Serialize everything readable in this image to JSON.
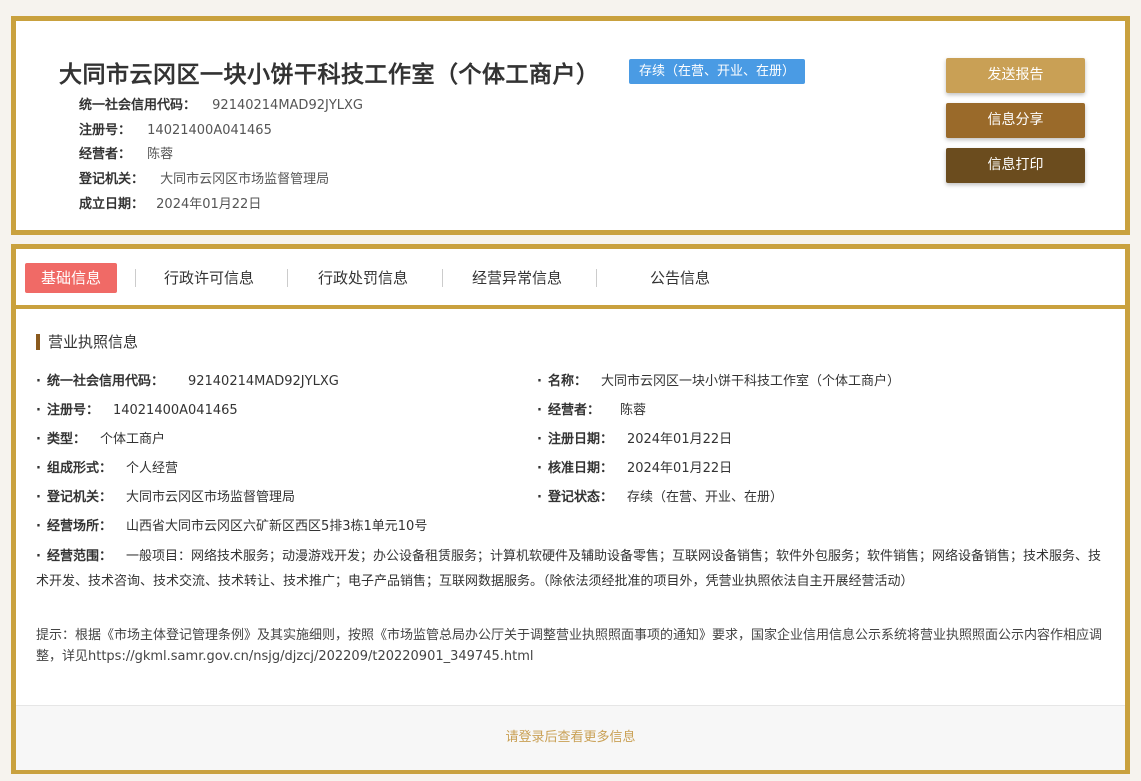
{
  "company": {
    "name": "大同市云冈区一块小饼干科技工作室（个体工商户）",
    "status": "存续（在营、开业、在册）"
  },
  "summary": [
    {
      "label": "统一社会信用代码：",
      "value": "92140214MAD92JYLXG"
    },
    {
      "label": "注册号：",
      "value": "14021400A041465"
    },
    {
      "label": "经营者：",
      "value": "陈蓉"
    },
    {
      "label": "登记机关：",
      "value": "大同市云冈区市场监督管理局"
    },
    {
      "label": "成立日期：",
      "value": "2024年01月22日"
    }
  ],
  "actions": {
    "report": "发送报告",
    "share": "信息分享",
    "print": "信息打印"
  },
  "tabs": [
    "基础信息",
    "行政许可信息",
    "行政处罚信息",
    "经营异常信息",
    "公告信息"
  ],
  "section": {
    "title": "营业执照信息"
  },
  "license": {
    "credit_code": {
      "label": "统一社会信用代码：",
      "value": "92140214MAD92JYLXG"
    },
    "name": {
      "label": "名称：",
      "value": "大同市云冈区一块小饼干科技工作室（个体工商户）"
    },
    "reg_no": {
      "label": "注册号：",
      "value": "14021400A041465"
    },
    "operator": {
      "label": "经营者：",
      "value": "陈蓉"
    },
    "type": {
      "label": "类型：",
      "value": "个体工商户"
    },
    "reg_date": {
      "label": "注册日期：",
      "value": "2024年01月22日"
    },
    "form": {
      "label": "组成形式：",
      "value": "个人经营"
    },
    "approve_date": {
      "label": "核准日期：",
      "value": "2024年01月22日"
    },
    "authority": {
      "label": "登记机关：",
      "value": "大同市云冈区市场监督管理局"
    },
    "reg_status": {
      "label": "登记状态：",
      "value": "存续（在营、开业、在册）"
    },
    "address": {
      "label": "经营场所：",
      "value": "山西省大同市云冈区六矿新区西区5排3栋1单元10号"
    },
    "scope": {
      "label": "经营范围：",
      "value": "一般项目：网络技术服务；动漫游戏开发；办公设备租赁服务；计算机软硬件及辅助设备零售；互联网设备销售；软件外包服务；软件销售；网络设备销售；技术服务、技术开发、技术咨询、技术交流、技术转让、技术推广；电子产品销售；互联网数据服务。（除依法须经批准的项目外，凭营业执照依法自主开展经营活动）"
    }
  },
  "notice": "提示：根据《市场主体登记管理条例》及其实施细则，按照《市场监管总局办公厅关于调整营业执照照面事项的通知》要求，国家企业信用信息公示系统将营业执照照面公示内容作相应调整，详见https://gkml.samr.gov.cn/nsjg/djzcj/202209/t20220901_349745.html",
  "login_prompt": "请登录后查看更多信息"
}
